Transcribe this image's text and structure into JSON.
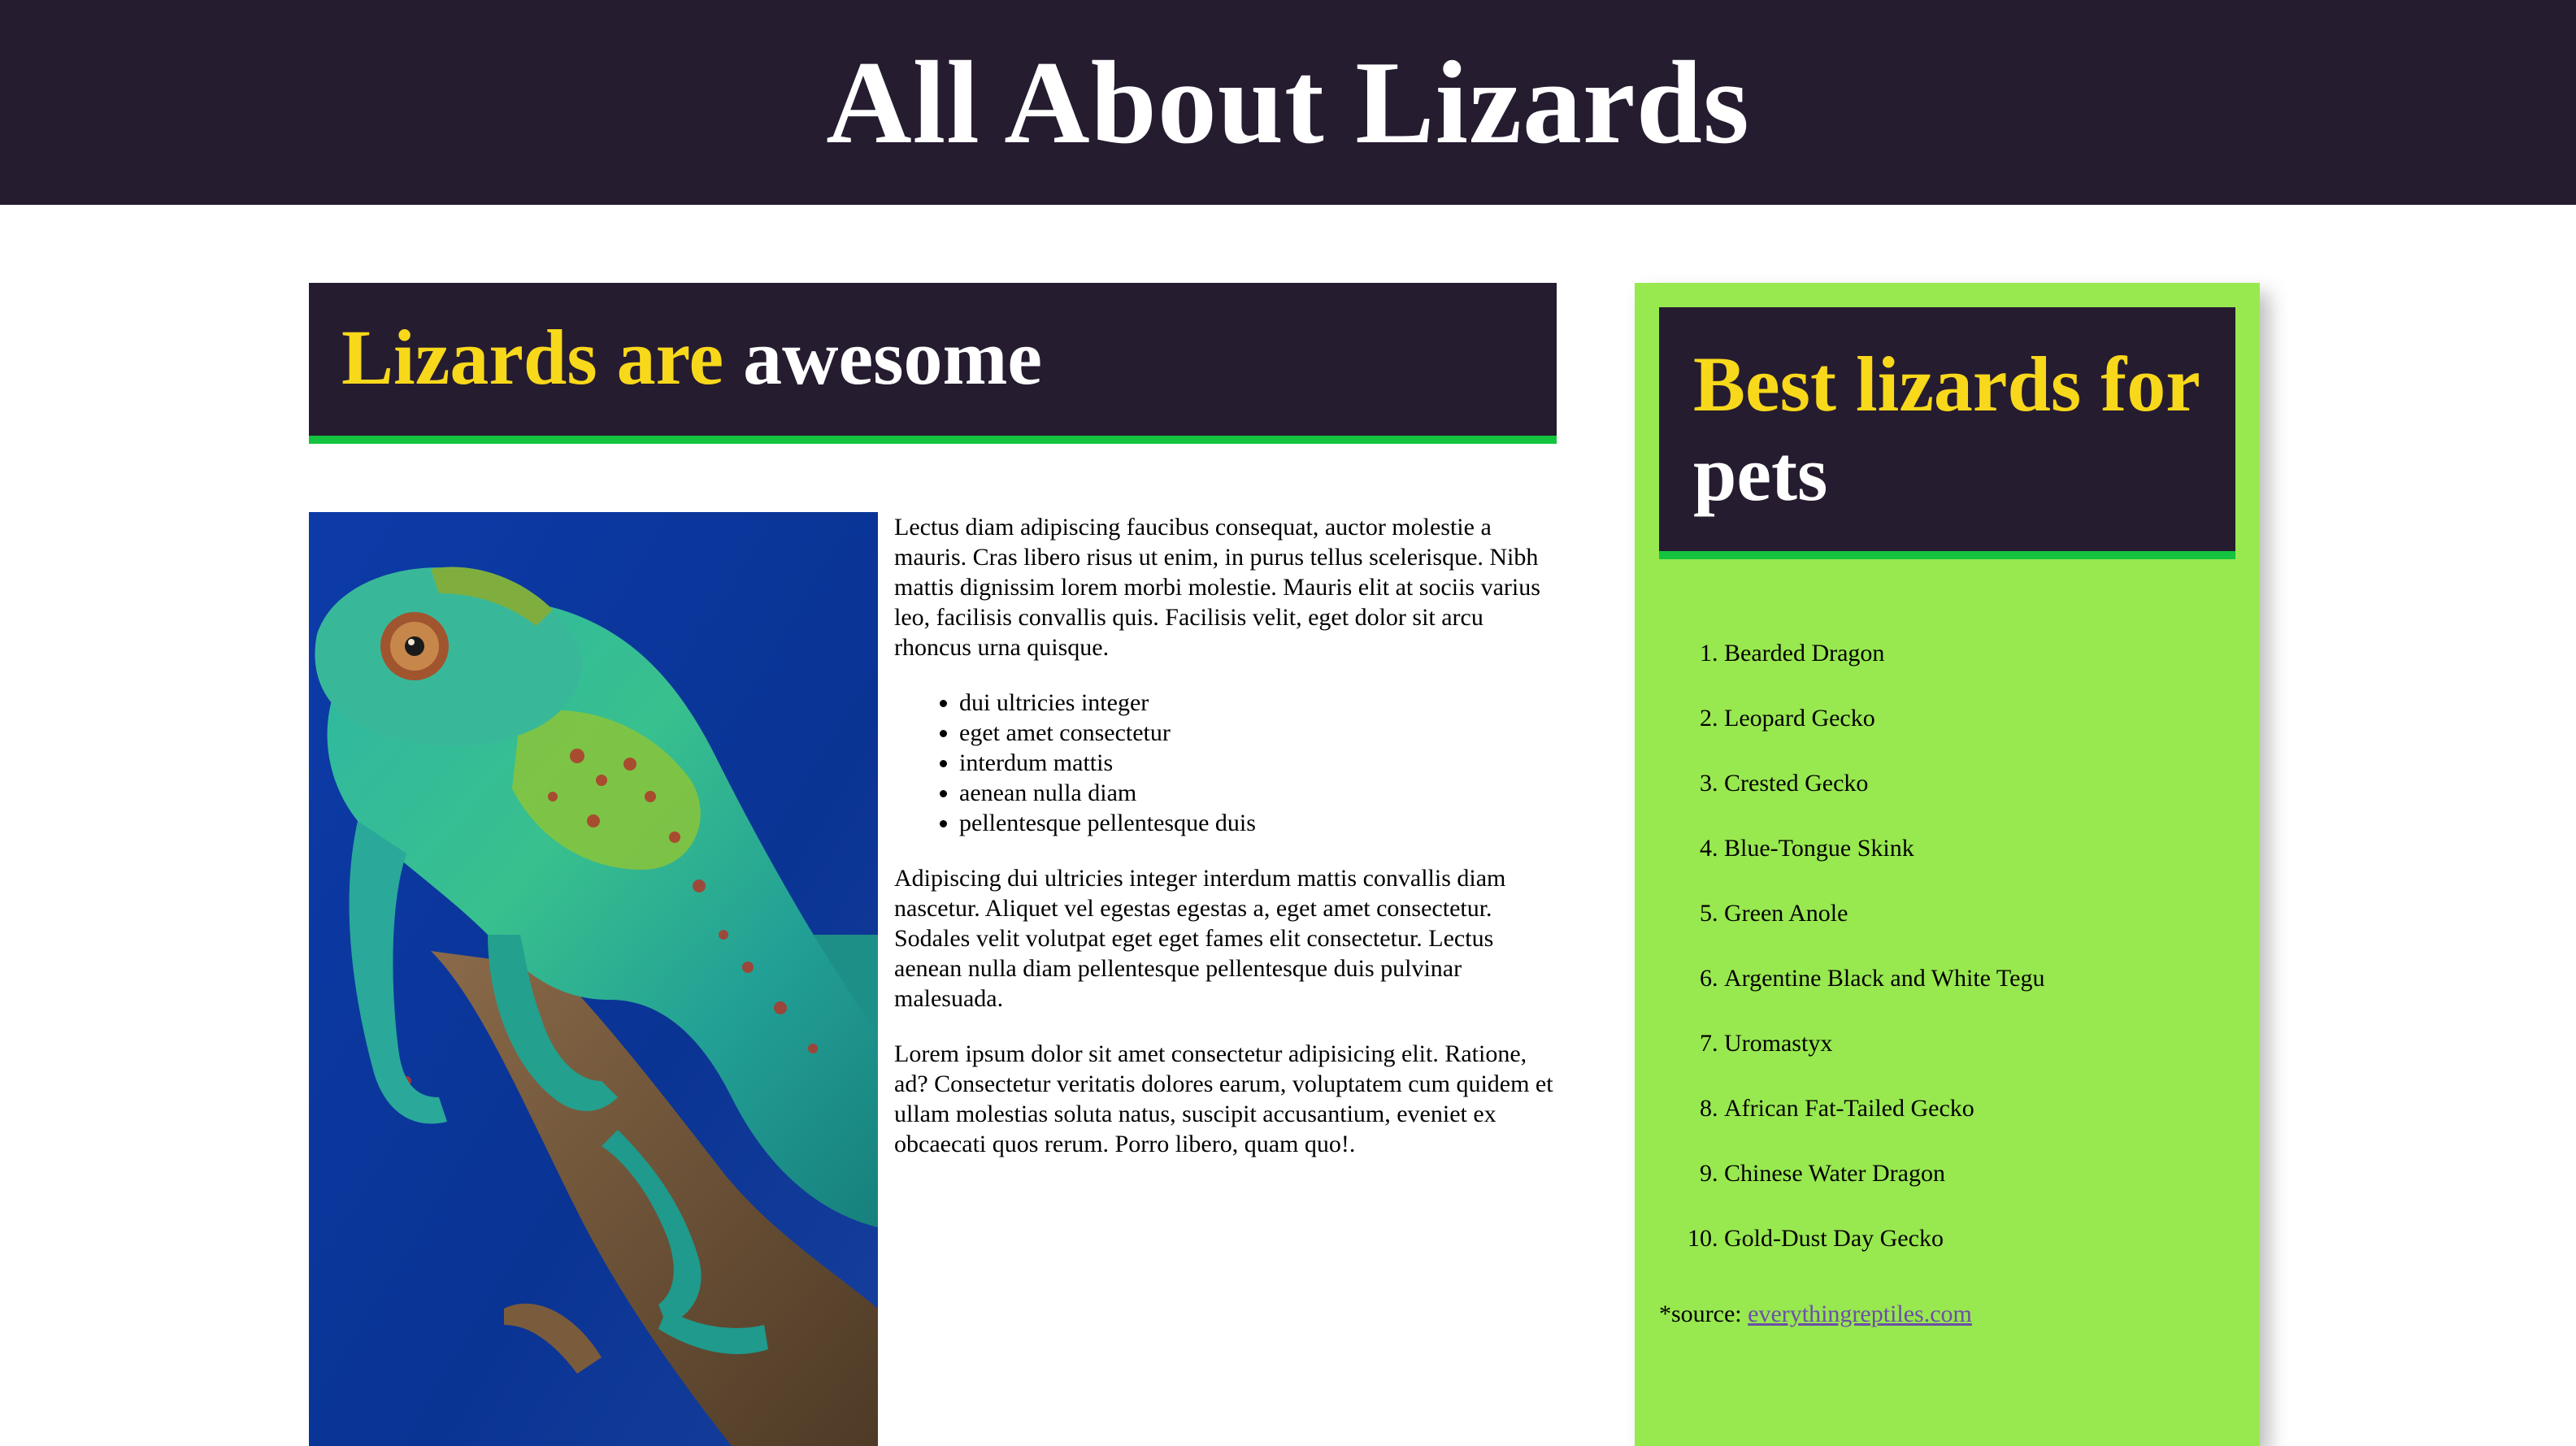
{
  "header": {
    "title": "All About Lizards"
  },
  "article": {
    "heading_highlight": "Lizards are",
    "heading_rest": "awesome",
    "image_alt": "Panther chameleon on a branch",
    "paragraph_1": "Lectus diam adipiscing faucibus consequat, auctor molestie a mauris. Cras libero risus ut enim, in purus tellus scelerisque. Nibh mattis dignissim lorem morbi molestie. Mauris elit at sociis varius leo, facilisis convallis quis. Facilisis velit, eget dolor sit arcu rhoncus urna quisque.",
    "bullets": [
      "dui ultricies integer",
      "eget amet consectetur",
      "interdum mattis",
      "aenean nulla diam",
      "pellentesque pellentesque duis"
    ],
    "paragraph_2": "Adipiscing dui ultricies integer interdum mattis convallis diam nascetur. Aliquet vel egestas egestas a, eget amet consectetur. Sodales velit volutpat eget eget fames elit consectetur. Lectus aenean nulla diam pellentesque pellentesque duis pulvinar malesuada.",
    "paragraph_3": "Lorem ipsum dolor sit amet consectetur adipisicing elit. Ratione, ad? Consectetur veritatis dolores earum, voluptatem cum quidem et ullam molestias soluta natus, suscipit accusantium, eveniet ex obcaecati quos rerum. Porro libero, quam quo!."
  },
  "sidebar": {
    "heading_highlight": "Best lizards for",
    "heading_rest": "pets",
    "items": [
      "Bearded Dragon",
      "Leopard Gecko",
      "Crested Gecko",
      "Blue-Tongue Skink",
      "Green Anole",
      "Argentine Black and White Tegu",
      "Uromastyx",
      "African Fat-Tailed Gecko",
      "Chinese Water Dragon",
      "Gold-Dust Day Gecko"
    ],
    "source_label": "*source:",
    "source_link": "everythingreptiles.com"
  },
  "colors": {
    "header_bg": "#261c30",
    "accent_yellow": "#f8d81a",
    "accent_green_border": "#14c33e",
    "sidebar_bg": "#98e84f"
  }
}
